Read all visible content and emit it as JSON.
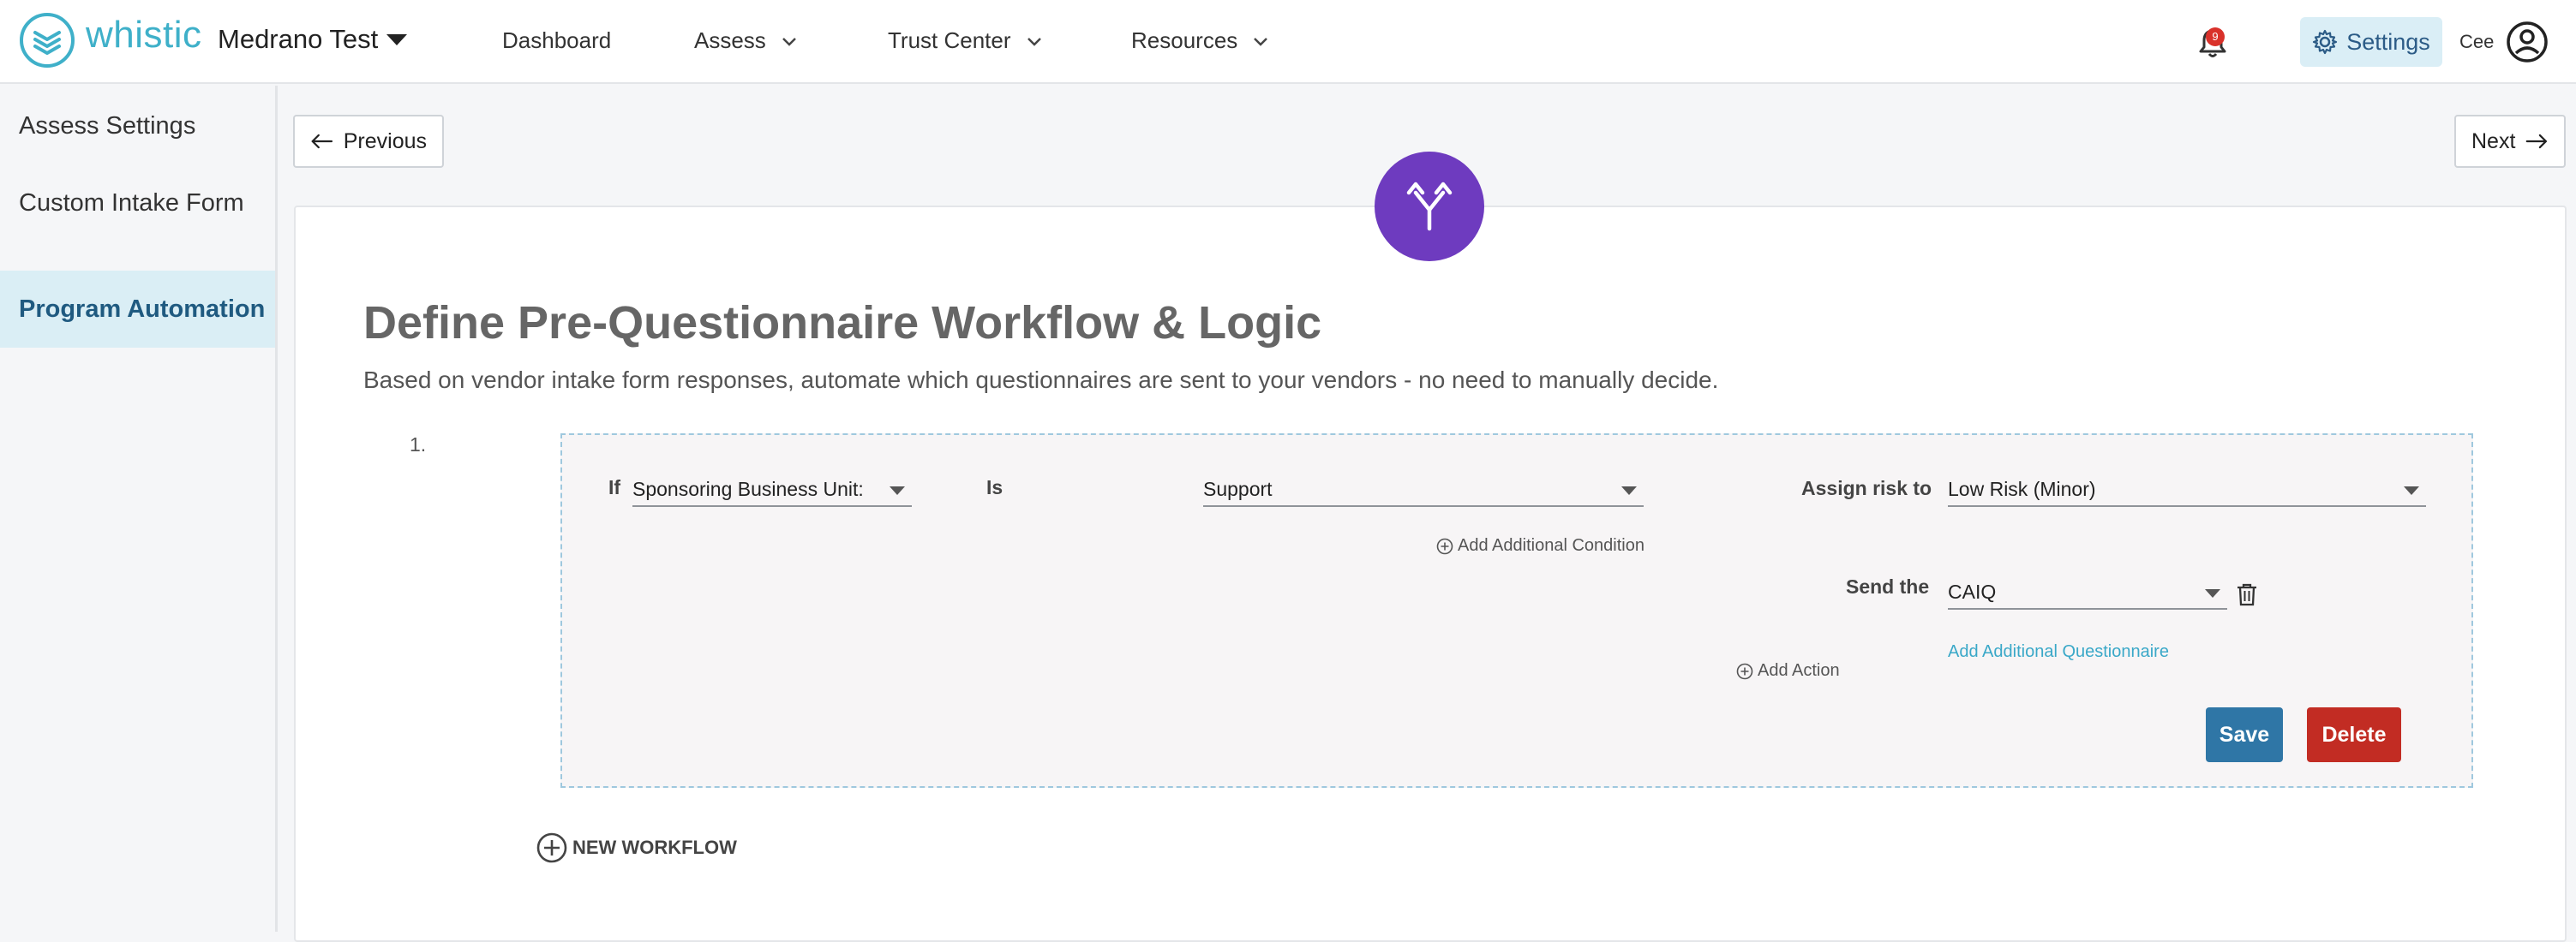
{
  "brand": {
    "name": "whistic",
    "color": "#3fb0c9"
  },
  "header": {
    "org_name": "Medrano Test",
    "nav": [
      {
        "label": "Dashboard"
      },
      {
        "label": "Assess"
      },
      {
        "label": "Trust Center"
      },
      {
        "label": "Resources"
      }
    ],
    "notifications_count": "9",
    "settings_label": "Settings",
    "user_name": "Cee"
  },
  "sidebar": {
    "items": [
      {
        "label": "Assess Settings"
      },
      {
        "label": "Custom Intake Form"
      },
      {
        "label": "Program Automation"
      }
    ],
    "active_index": 2
  },
  "pager": {
    "previous_label": "Previous",
    "next_label": "Next"
  },
  "main": {
    "title": "Define Pre-Questionnaire Workflow & Logic",
    "subtitle": "Based on vendor intake form responses, automate which questionnaires are sent to your vendors - no need to manually decide.",
    "icon": "workflow-branch-icon",
    "icon_color": "#6e3bbf"
  },
  "workflow": {
    "number": "1.",
    "if_label": "If",
    "field_value": "Sponsoring Business Unit:",
    "operator_label": "Is",
    "condition_value": "Support",
    "add_condition_label": "Add Additional Condition",
    "assign_risk_label": "Assign risk to",
    "risk_value": "Low Risk (Minor)",
    "send_label": "Send the",
    "questionnaire_value": "CAIQ",
    "add_questionnaire_label": "Add Additional Questionnaire",
    "add_action_label": "Add Action",
    "save_label": "Save",
    "delete_label": "Delete"
  },
  "new_workflow_label": "NEW WORKFLOW",
  "colors": {
    "save": "#2f76a6",
    "delete": "#c22c23",
    "active_sidebar_bg": "#daeef5"
  }
}
